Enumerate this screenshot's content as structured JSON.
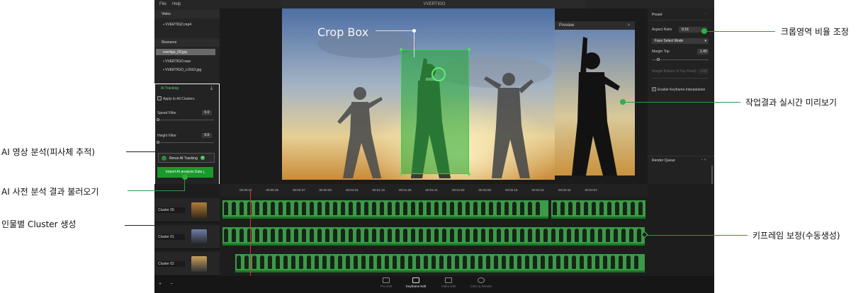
{
  "app": {
    "title": "VVERTIGO",
    "menu": [
      "File",
      "Help"
    ]
  },
  "left_panel": {
    "video_header": "Video",
    "video_files": [
      "VVERTIGO.mp4"
    ],
    "resource_header": "Resource",
    "resource_files": [
      "vvertigo_00.jpg",
      "VVERTIGO.wav",
      "VVERTIGO_LOGO.jpg"
    ],
    "ai_tracking": {
      "title": "AI Tracking",
      "apply_all_label": "Apply to All Clusters",
      "speed_filter_label": "Speed Filter",
      "speed_filter_value": "0.0",
      "height_filter_label": "Height Filter",
      "height_filter_value": "0.0",
      "rerun_label": "Rerun AI Tracking",
      "import_label": "Import AI analysis Data"
    }
  },
  "viewer": {
    "crop_box_label": "Crop Box",
    "preview_title": "Preview"
  },
  "right_panel": {
    "preset_header": "Preset",
    "aspect_ratio_label": "Aspect Ratio",
    "aspect_ratio_value": "9:16",
    "face_mode": "Face Select Mode",
    "margin_top_label": "Margin Top",
    "margin_top_value": "1.40",
    "margin_bottom_label": "Margin Bottom (if Top Fixed)",
    "margin_bottom_value": "1.00",
    "keyframe_interp_label": "Enable Keyframe Interpolation",
    "render_queue_header": "Render Queue"
  },
  "timeline": {
    "ticks": [
      "00:00:12",
      "00:00:25",
      "00:00:37",
      "00:00:50",
      "00:01:03",
      "00:01:15",
      "00:01:28",
      "00:01:41",
      "00:01:53",
      "00:02:06",
      "00:02:19",
      "00:02:31",
      "00:02:44",
      "00:02:57"
    ],
    "clusters": [
      "Cluster 00",
      "Cluster 01",
      "Cluster 02"
    ],
    "zoom_in": "+",
    "zoom_out": "−"
  },
  "bottom_bar": {
    "modes": [
      "Pre Edit",
      "Keyframe Edit",
      "Video Edit",
      "Color & Render"
    ],
    "active_mode": "Keyframe Edit"
  },
  "annotations": {
    "crop_ratio": "크롭영역 비율 조정",
    "realtime_preview": "작업결과 실시간 미리보기",
    "ai_analysis": "AI 영상 분석(피사체 추적)",
    "ai_import": "AI 사전 분석 결과 불러오기",
    "cluster_per_person": "인물별 Cluster 생성",
    "keyframe_correction": "키프레임 보정(수동생성)"
  },
  "colors": {
    "accent_green": "#1a9a2a",
    "annotation_green": "#2c9a3c",
    "playhead_red": "#d53636",
    "clip_green": "#3d9a48"
  }
}
